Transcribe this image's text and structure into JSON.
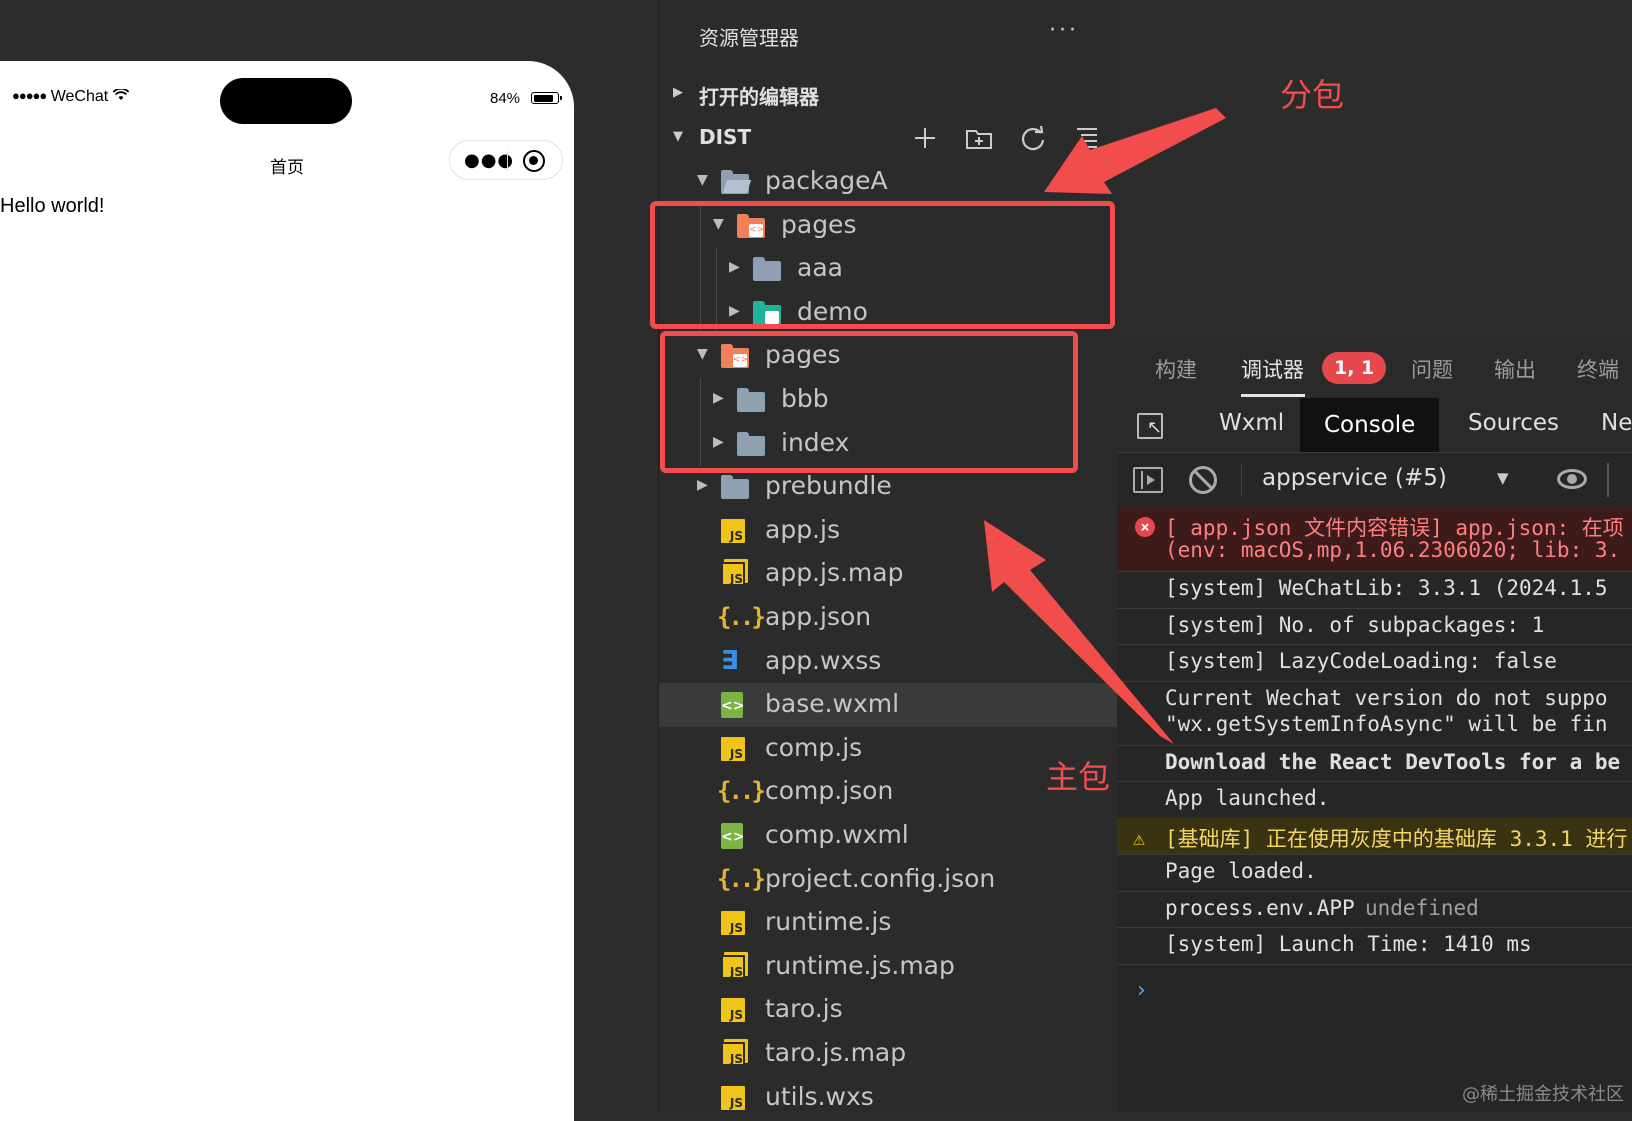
{
  "simulator": {
    "carrier": "WeChat",
    "battery_pct": "84%",
    "battery_level": 0.84,
    "nav_title": "首页",
    "content_text": "Hello world!"
  },
  "explorer": {
    "title": "资源管理器",
    "menu_label": "···",
    "open_editors_label": "打开的编辑器",
    "dist_label": "DIST",
    "tree": [
      {
        "name": "packageA",
        "depth": 0,
        "kind": "folder-open",
        "expanded": true
      },
      {
        "name": "pages",
        "depth": 1,
        "kind": "folder-pages",
        "expanded": true
      },
      {
        "name": "aaa",
        "depth": 2,
        "kind": "folder",
        "expanded": false
      },
      {
        "name": "demo",
        "depth": 2,
        "kind": "folder-image",
        "expanded": false
      },
      {
        "name": "pages",
        "depth": 0,
        "kind": "folder-pages",
        "expanded": true
      },
      {
        "name": "bbb",
        "depth": 1,
        "kind": "folder",
        "expanded": false
      },
      {
        "name": "index",
        "depth": 1,
        "kind": "folder",
        "expanded": false
      },
      {
        "name": "prebundle",
        "depth": 0,
        "kind": "folder",
        "expanded": false
      },
      {
        "name": "app.js",
        "depth": 0,
        "kind": "js"
      },
      {
        "name": "app.js.map",
        "depth": 0,
        "kind": "jsmap"
      },
      {
        "name": "app.json",
        "depth": 0,
        "kind": "json"
      },
      {
        "name": "app.wxss",
        "depth": 0,
        "kind": "css"
      },
      {
        "name": "base.wxml",
        "depth": 0,
        "kind": "wxml",
        "selected": true
      },
      {
        "name": "comp.js",
        "depth": 0,
        "kind": "js"
      },
      {
        "name": "comp.json",
        "depth": 0,
        "kind": "json"
      },
      {
        "name": "comp.wxml",
        "depth": 0,
        "kind": "wxml"
      },
      {
        "name": "project.config.json",
        "depth": 0,
        "kind": "json"
      },
      {
        "name": "runtime.js",
        "depth": 0,
        "kind": "js"
      },
      {
        "name": "runtime.js.map",
        "depth": 0,
        "kind": "jsmap"
      },
      {
        "name": "taro.js",
        "depth": 0,
        "kind": "js"
      },
      {
        "name": "taro.js.map",
        "depth": 0,
        "kind": "jsmap"
      },
      {
        "name": "utils.wxs",
        "depth": 0,
        "kind": "js"
      }
    ]
  },
  "annotations": {
    "subpackage_label": "分包",
    "main_package_label": "主包"
  },
  "devtools": {
    "tabs": [
      "构建",
      "调试器",
      "问题",
      "输出",
      "终端"
    ],
    "active_tab": "调试器",
    "badge": "1, 1",
    "subtabs": [
      "Wxml",
      "Console",
      "Sources",
      "Ne"
    ],
    "active_subtab": "Console",
    "context": "appservice (#5)",
    "console": [
      {
        "level": "error",
        "lines": [
          "[ app.json 文件内容错误] app.json: 在项",
          "(env: macOS,mp,1.06.2306020; lib: 3."
        ]
      },
      {
        "level": "log",
        "lines": [
          "[system] WeChatLib: 3.3.1 (2024.1.5"
        ]
      },
      {
        "level": "log",
        "lines": [
          "[system] No. of subpackages: 1"
        ]
      },
      {
        "level": "log",
        "lines": [
          "[system] LazyCodeLoading: false"
        ]
      },
      {
        "level": "log",
        "lines": [
          "Current Wechat version do not suppo",
          "\"wx.getSystemInfoAsync\" will be fin"
        ]
      },
      {
        "level": "log",
        "bold": true,
        "lines": [
          "Download the React DevTools for a be"
        ]
      },
      {
        "level": "log",
        "lines": [
          "App launched."
        ]
      },
      {
        "level": "warn",
        "lines": [
          "[基础库] 正在使用灰度中的基础库 3.3.1 进行"
        ]
      },
      {
        "level": "log",
        "lines": [
          "Page loaded."
        ]
      },
      {
        "level": "log",
        "lines": [
          "process.env.APP"
        ],
        "suffix": "undefined"
      },
      {
        "level": "log",
        "lines": [
          "[system] Launch Time: 1410 ms"
        ]
      }
    ],
    "prompt": "›"
  },
  "watermark": "@稀土掘金技术社区",
  "colors": {
    "annotation": "#f24d4d",
    "badge": "#e5484d",
    "js": "#f0c419",
    "json": "#e2b634",
    "wxss": "#3a8ee6",
    "wxml": "#7cb342",
    "folder": "#8fa0b3",
    "pages_folder": "#f0805a",
    "image_folder": "#1fb39a"
  }
}
